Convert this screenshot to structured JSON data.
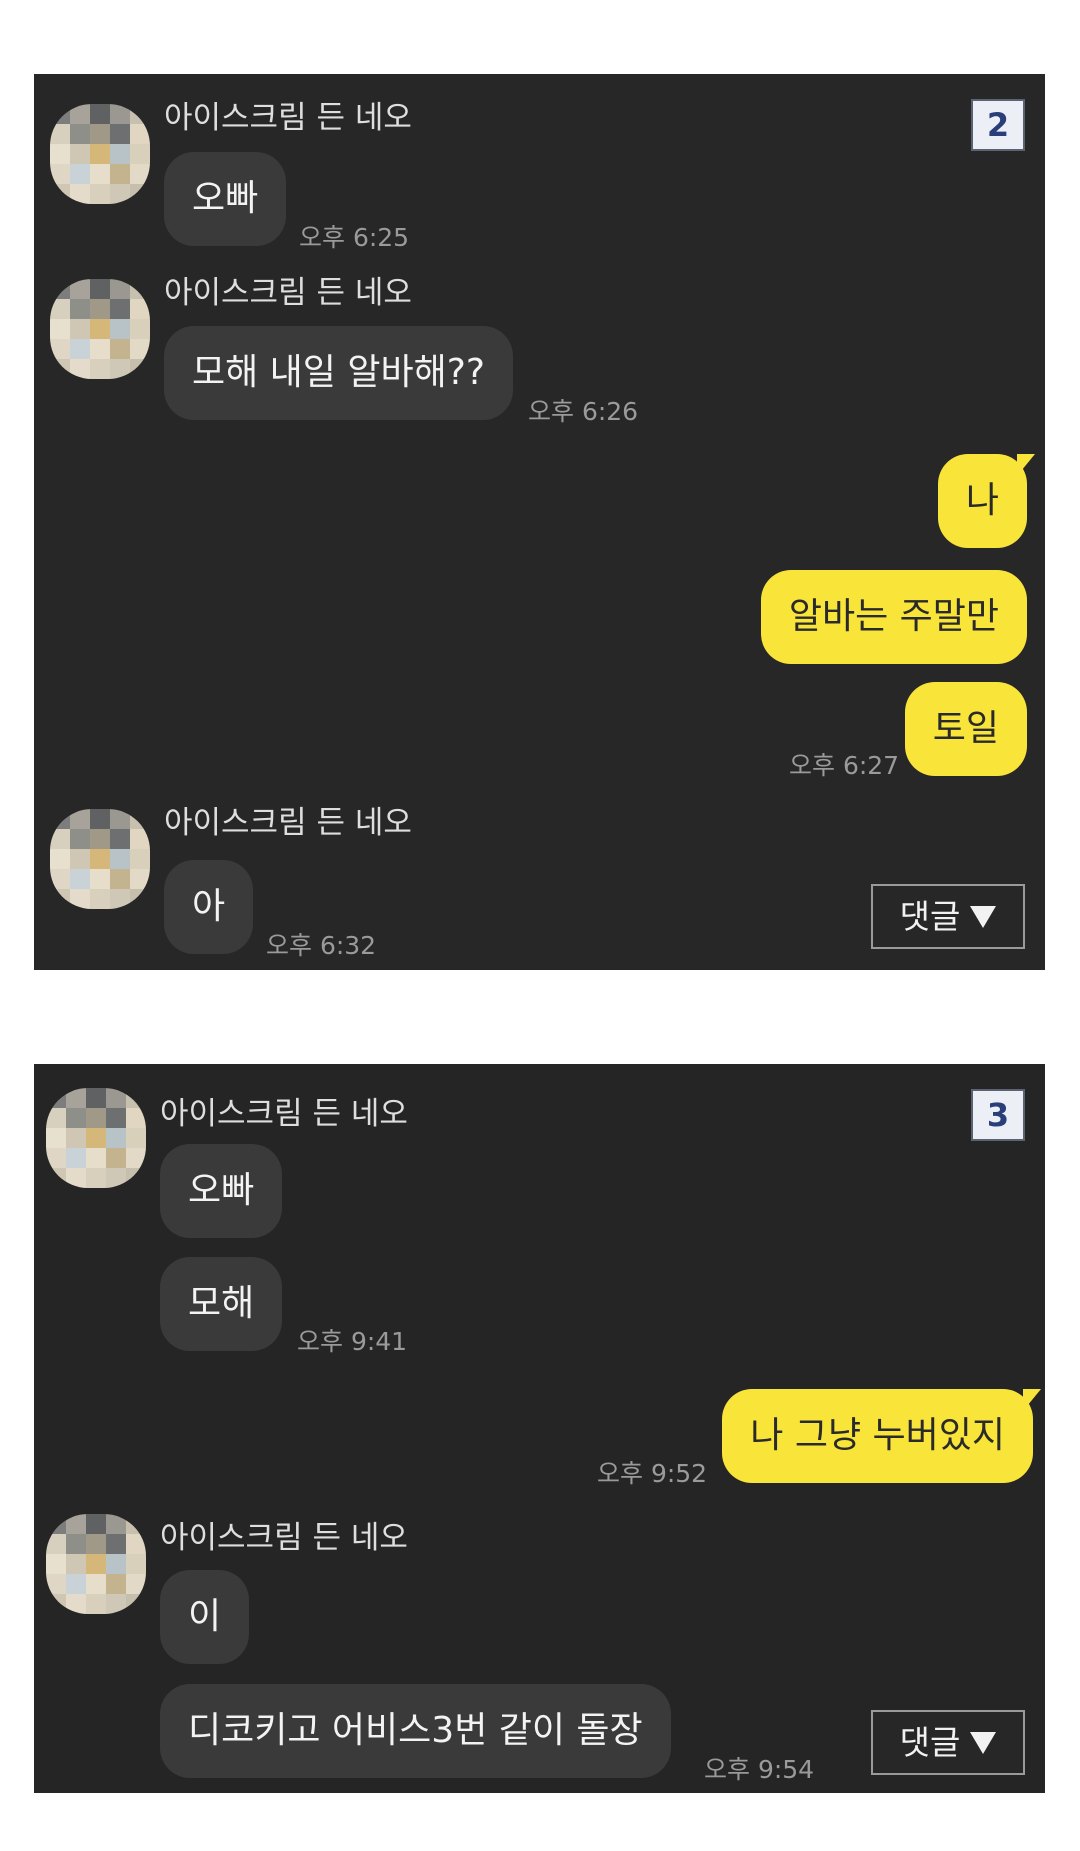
{
  "panels": [
    {
      "number": "2",
      "comment_label": "댓글",
      "sender_name": "아이스크림 든 네오",
      "messages": {
        "m1": "오빠",
        "t1": "오후 6:25",
        "m2": "모해 내일 알바해??",
        "t2": "오후 6:26",
        "r1": "나",
        "r2": "알바는 주말만",
        "r3": "토일",
        "t3": "오후 6:27",
        "m3": "아",
        "t4": "오후 6:32"
      }
    },
    {
      "number": "3",
      "comment_label": "댓글",
      "sender_name": "아이스크림 든 네오",
      "messages": {
        "m1": "오빠",
        "m2": "모해",
        "t1": "오후 9:41",
        "r1": "나 그냥 누버있지",
        "t2": "오후 9:52",
        "m3": "이",
        "m4": "디코키고 어비스3번 같이 돌장",
        "t3": "오후 9:54"
      }
    }
  ],
  "colors": {
    "chat_background": "#272727",
    "incoming_bubble": "#3a3a3a",
    "outgoing_bubble": "#f9e43a",
    "badge_text": "#2a3f7a"
  }
}
